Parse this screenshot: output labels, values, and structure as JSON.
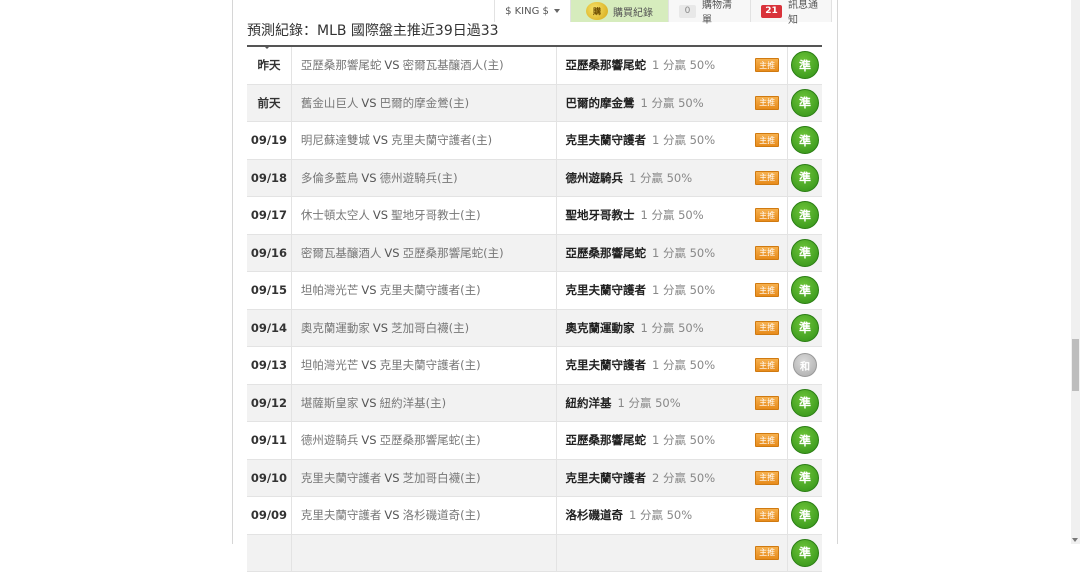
{
  "topbar": {
    "account": "$ KING $",
    "coin_icon": "購",
    "buy_record": "購買紀錄",
    "cart_count": "0",
    "cart_label": "購物清單",
    "notice_count": "21",
    "notice_label": "訊息通知"
  },
  "heading": "預測紀錄：MLB 國際盤主推近39日過33",
  "vs": "VS",
  "rows": [
    {
      "date": "昨天",
      "away": "亞歷桑那響尾蛇",
      "home": "密爾瓦基釀酒人(主)",
      "pick": "亞歷桑那響尾蛇",
      "stat": "1 分贏 50%",
      "tag": "主推",
      "result": "準"
    },
    {
      "date": "前天",
      "away": "舊金山巨人",
      "home": "巴爾的摩金鶯(主)",
      "pick": "巴爾的摩金鶯",
      "stat": "1 分贏 50%",
      "tag": "主推",
      "result": "準"
    },
    {
      "date": "09/19",
      "away": "明尼蘇達雙城",
      "home": "克里夫蘭守護者(主)",
      "pick": "克里夫蘭守護者",
      "stat": "1 分贏 50%",
      "tag": "主推",
      "result": "準"
    },
    {
      "date": "09/18",
      "away": "多倫多藍鳥",
      "home": "德州遊騎兵(主)",
      "pick": "德州遊騎兵",
      "stat": "1 分贏 50%",
      "tag": "主推",
      "result": "準"
    },
    {
      "date": "09/17",
      "away": "休士頓太空人",
      "home": "聖地牙哥教士(主)",
      "pick": "聖地牙哥教士",
      "stat": "1 分贏 50%",
      "tag": "主推",
      "result": "準"
    },
    {
      "date": "09/16",
      "away": "密爾瓦基釀酒人",
      "home": "亞歷桑那響尾蛇(主)",
      "pick": "亞歷桑那響尾蛇",
      "stat": "1 分贏 50%",
      "tag": "主推",
      "result": "準"
    },
    {
      "date": "09/15",
      "away": "坦帕灣光芒",
      "home": "克里夫蘭守護者(主)",
      "pick": "克里夫蘭守護者",
      "stat": "1 分贏 50%",
      "tag": "主推",
      "result": "準"
    },
    {
      "date": "09/14",
      "away": "奧克蘭運動家",
      "home": "芝加哥白襪(主)",
      "pick": "奧克蘭運動家",
      "stat": "1 分贏 50%",
      "tag": "主推",
      "result": "準"
    },
    {
      "date": "09/13",
      "away": "坦帕灣光芒",
      "home": "克里夫蘭守護者(主)",
      "pick": "克里夫蘭守護者",
      "stat": "1 分贏 50%",
      "tag": "主推",
      "result": "和",
      "push": true
    },
    {
      "date": "09/12",
      "away": "堪薩斯皇家",
      "home": "紐約洋基(主)",
      "pick": "紐約洋基",
      "stat": "1 分贏 50%",
      "tag": "主推",
      "result": "準"
    },
    {
      "date": "09/11",
      "away": "德州遊騎兵",
      "home": "亞歷桑那響尾蛇(主)",
      "pick": "亞歷桑那響尾蛇",
      "stat": "1 分贏 50%",
      "tag": "主推",
      "result": "準"
    },
    {
      "date": "09/10",
      "away": "克里夫蘭守護者",
      "home": "芝加哥白襪(主)",
      "pick": "克里夫蘭守護者",
      "stat": "2 分贏 50%",
      "tag": "主推",
      "result": "準"
    },
    {
      "date": "09/09",
      "away": "克里夫蘭守護者",
      "home": "洛杉磯道奇(主)",
      "pick": "洛杉磯道奇",
      "stat": "1 分贏 50%",
      "tag": "主推",
      "result": "準"
    },
    {
      "date": "",
      "away": "",
      "home": "",
      "pick": "",
      "stat": "",
      "tag": "主推",
      "result": "準"
    }
  ]
}
